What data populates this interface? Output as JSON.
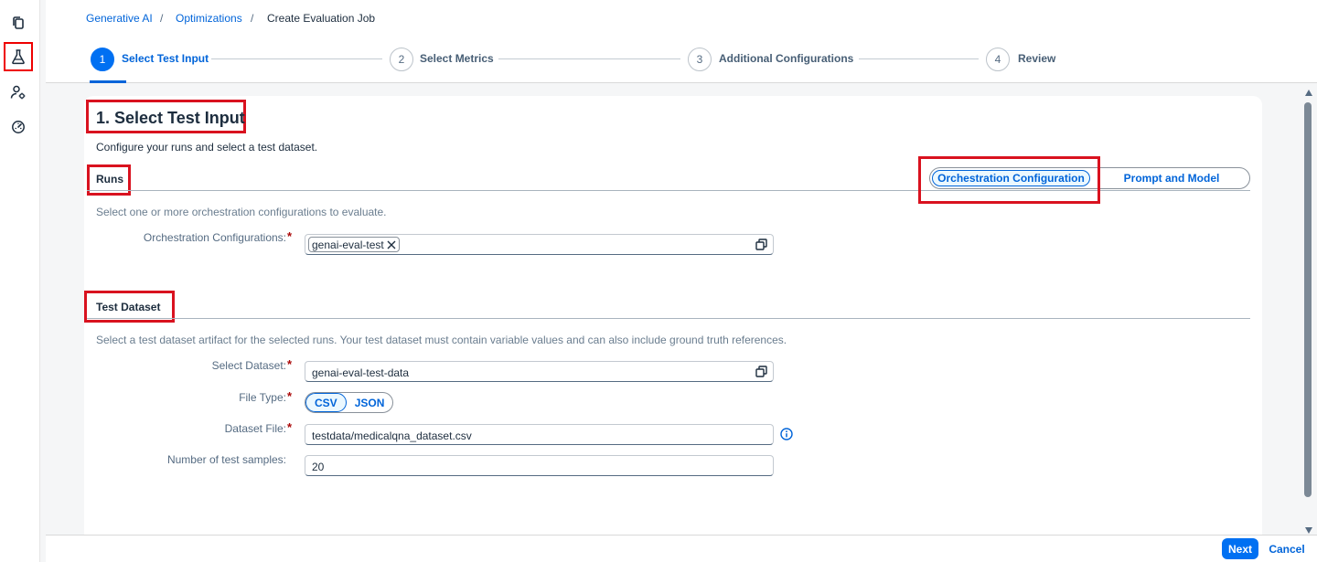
{
  "nav": {
    "icons": [
      "copy-icon",
      "flask-icon",
      "user-settings-icon",
      "gauge-icon"
    ]
  },
  "breadcrumb": {
    "items": [
      "Generative AI",
      "Optimizations",
      "Create Evaluation Job"
    ],
    "separator": "/"
  },
  "steps": [
    {
      "number": "1",
      "label": "Select Test Input"
    },
    {
      "number": "2",
      "label": "Select Metrics"
    },
    {
      "number": "3",
      "label": "Additional Configurations"
    },
    {
      "number": "4",
      "label": "Review"
    }
  ],
  "section": {
    "title": "1. Select Test Input",
    "description": "Configure your runs and select a test dataset."
  },
  "runs": {
    "title": "Runs",
    "toggle": {
      "options": [
        "Orchestration Configuration",
        "Prompt and Model"
      ],
      "selected": "Orchestration Configuration"
    },
    "description": "Select one or more orchestration configurations to evaluate.",
    "orchestration_label": "Orchestration Configurations:",
    "required_mark": "*",
    "token": "genai-eval-test"
  },
  "dataset": {
    "title": "Test Dataset",
    "description": "Select a test dataset artifact for the selected runs. Your test dataset must contain variable values and can also include ground truth references.",
    "select_label": "Select Dataset:",
    "select_value": "genai-eval-test-data",
    "filetype_label": "File Type:",
    "filetype_options": [
      "CSV",
      "JSON"
    ],
    "filetype_selected": "CSV",
    "file_label": "Dataset File:",
    "file_value": "testdata/medicalqna_dataset.csv",
    "samples_label": "Number of test samples:",
    "samples_value": "20"
  },
  "footer": {
    "next_label": "Next",
    "cancel_label": "Cancel"
  },
  "colors": {
    "accent": "#0070f2",
    "link": "#0064d9",
    "highlight_box": "#d9121f"
  }
}
